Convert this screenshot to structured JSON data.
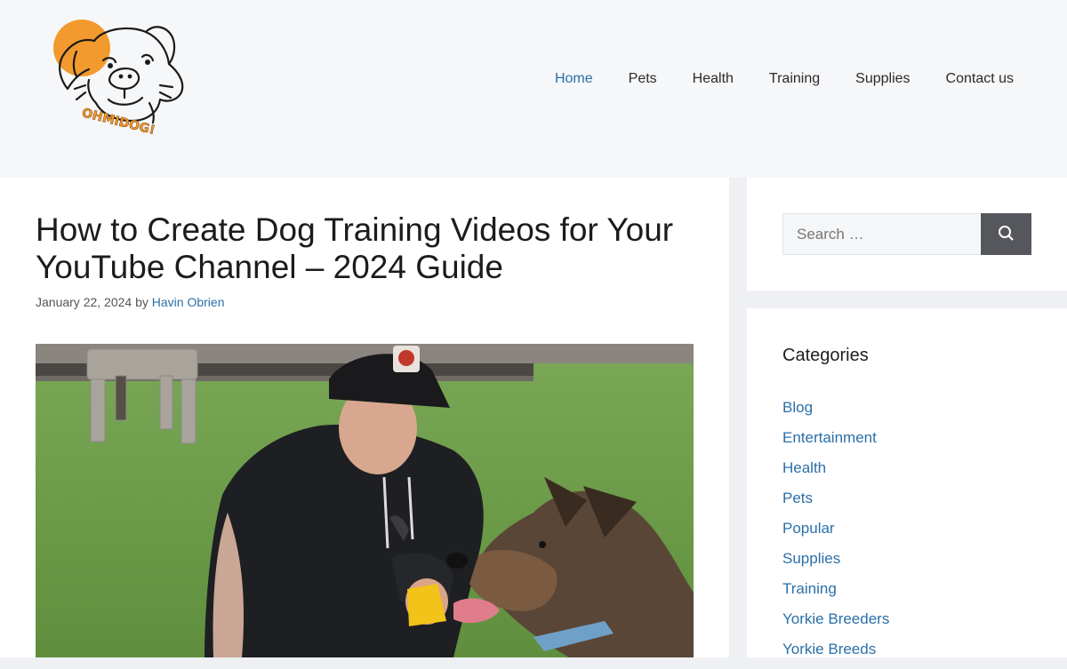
{
  "header": {
    "logo_text": "OHMIDOG!",
    "nav": [
      {
        "label": "Home",
        "active": true
      },
      {
        "label": "Pets",
        "active": false
      },
      {
        "label": "Health",
        "active": false
      },
      {
        "label": "Training",
        "active": false
      },
      {
        "label": "Supplies",
        "active": false
      },
      {
        "label": "Contact us",
        "active": false
      }
    ]
  },
  "article": {
    "title": "How to Create Dog Training Videos for Your YouTube Channel – 2024 Guide",
    "date": "January 22, 2024",
    "by": "by",
    "author": "Havin Obrien"
  },
  "sidebar": {
    "search": {
      "placeholder": "Search …",
      "button_icon": "search-icon"
    },
    "categories": {
      "title": "Categories",
      "items": [
        "Blog",
        "Entertainment",
        "Health",
        "Pets",
        "Popular",
        "Supplies",
        "Training",
        "Yorkie Breeders",
        "Yorkie Breeds"
      ]
    }
  },
  "colors": {
    "link": "#2b6fa8",
    "header_bg": "#f6f7f9",
    "logo_accent": "#f29a2e",
    "search_button": "#55575c"
  }
}
